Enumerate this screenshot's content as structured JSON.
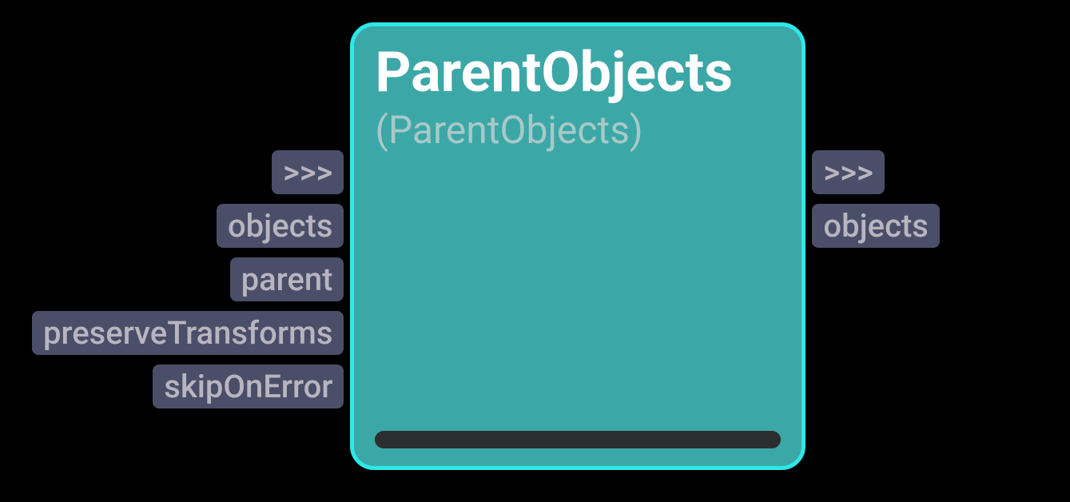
{
  "node": {
    "title": "ParentObjects",
    "subtitle": "(ParentObjects)"
  },
  "inputs": [
    {
      "label": ">>>"
    },
    {
      "label": "objects"
    },
    {
      "label": "parent"
    },
    {
      "label": "preserveTransforms"
    },
    {
      "label": "skipOnError"
    }
  ],
  "outputs": [
    {
      "label": ">>>"
    },
    {
      "label": "objects"
    }
  ]
}
